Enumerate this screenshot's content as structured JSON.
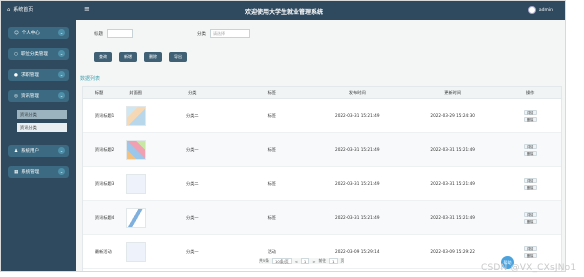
{
  "header": {
    "home_label": "系统首页",
    "menu_icon": "≡",
    "title": "欢迎使用大学生就业管理系统",
    "user_name": "admin"
  },
  "sidebar": {
    "items": [
      {
        "label": "个人中心",
        "icon": "user-icon"
      },
      {
        "label": "职位分类管理",
        "icon": "briefcase-icon"
      },
      {
        "label": "求职管理",
        "icon": "dot-icon"
      },
      {
        "label": "资讯管理",
        "icon": "news-icon"
      }
    ],
    "sub_items": [
      {
        "label": "资讯分类"
      },
      {
        "label": "资讯分类"
      }
    ],
    "items_bottom": [
      {
        "label": "系统用户"
      },
      {
        "label": "系统管理"
      }
    ]
  },
  "search": {
    "label1": "标题",
    "label2": "分类",
    "placeholder2": "请选择"
  },
  "toolbar": {
    "btn1": "查询",
    "btn2": "新增",
    "btn3": "删除",
    "btn4": "导出"
  },
  "section_title": "数据列表",
  "table": {
    "headers": [
      "标题",
      "封面图",
      "分类",
      "标签",
      "发布时间",
      "更新时间",
      "操作"
    ],
    "rows": [
      {
        "title": "资讯标题1",
        "category": "分类二",
        "tag": "标签",
        "published": "2022-03-31 15:21:49",
        "updated": "2022-03-29 15:24:30",
        "thumb": "img1"
      },
      {
        "title": "资讯标题2",
        "category": "分类一",
        "tag": "标签",
        "published": "2022-03-31 15:21:49",
        "updated": "2022-03-31 15:21:49",
        "thumb": "img2"
      },
      {
        "title": "资讯标题3",
        "category": "分类二",
        "tag": "标签",
        "published": "2022-03-31 15:21:49",
        "updated": "2022-03-31 15:21:49",
        "thumb": "img3"
      },
      {
        "title": "资讯标题4",
        "category": "分类一",
        "tag": "标签",
        "published": "2022-03-31 15:21:49",
        "updated": "2022-03-31 15:21:49",
        "thumb": "img4"
      },
      {
        "title": "最新活动",
        "category": "分类一",
        "tag": "活动",
        "published": "2022-03-09 15:29:14",
        "updated": "2022-03-09 15:29:22",
        "thumb": "img3"
      }
    ],
    "op_edit": "详情",
    "op_delete": "删除"
  },
  "pager": {
    "total": "共5条",
    "size": "10条/页",
    "prev": "<",
    "page": "1",
    "next": ">",
    "goto": "前往",
    "page_input": "1",
    "unit": "页"
  },
  "fab_label": "帮助",
  "watermark": "CSDN @VX_CXsJNo1",
  "colors": {
    "header_bg": "#2f4a5f",
    "sidebar_bg": "#2f4a5f",
    "accent": "#47a3b0",
    "button_bg": "#3f6075"
  }
}
